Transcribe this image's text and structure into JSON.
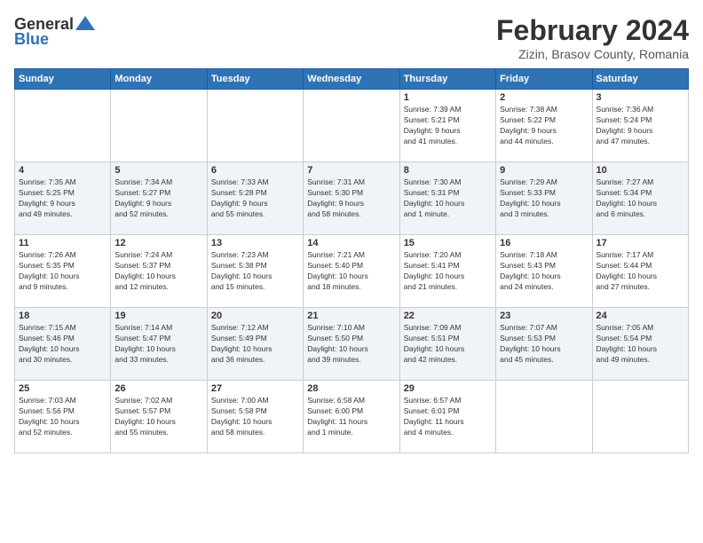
{
  "header": {
    "logo_line1": "General",
    "logo_line2": "Blue",
    "title": "February 2024",
    "subtitle": "Zizin, Brasov County, Romania"
  },
  "weekdays": [
    "Sunday",
    "Monday",
    "Tuesday",
    "Wednesday",
    "Thursday",
    "Friday",
    "Saturday"
  ],
  "weeks": [
    [
      {
        "day": "",
        "detail": ""
      },
      {
        "day": "",
        "detail": ""
      },
      {
        "day": "",
        "detail": ""
      },
      {
        "day": "",
        "detail": ""
      },
      {
        "day": "1",
        "detail": "Sunrise: 7:39 AM\nSunset: 5:21 PM\nDaylight: 9 hours\nand 41 minutes."
      },
      {
        "day": "2",
        "detail": "Sunrise: 7:38 AM\nSunset: 5:22 PM\nDaylight: 9 hours\nand 44 minutes."
      },
      {
        "day": "3",
        "detail": "Sunrise: 7:36 AM\nSunset: 5:24 PM\nDaylight: 9 hours\nand 47 minutes."
      }
    ],
    [
      {
        "day": "4",
        "detail": "Sunrise: 7:35 AM\nSunset: 5:25 PM\nDaylight: 9 hours\nand 49 minutes."
      },
      {
        "day": "5",
        "detail": "Sunrise: 7:34 AM\nSunset: 5:27 PM\nDaylight: 9 hours\nand 52 minutes."
      },
      {
        "day": "6",
        "detail": "Sunrise: 7:33 AM\nSunset: 5:28 PM\nDaylight: 9 hours\nand 55 minutes."
      },
      {
        "day": "7",
        "detail": "Sunrise: 7:31 AM\nSunset: 5:30 PM\nDaylight: 9 hours\nand 58 minutes."
      },
      {
        "day": "8",
        "detail": "Sunrise: 7:30 AM\nSunset: 5:31 PM\nDaylight: 10 hours\nand 1 minute."
      },
      {
        "day": "9",
        "detail": "Sunrise: 7:29 AM\nSunset: 5:33 PM\nDaylight: 10 hours\nand 3 minutes."
      },
      {
        "day": "10",
        "detail": "Sunrise: 7:27 AM\nSunset: 5:34 PM\nDaylight: 10 hours\nand 6 minutes."
      }
    ],
    [
      {
        "day": "11",
        "detail": "Sunrise: 7:26 AM\nSunset: 5:35 PM\nDaylight: 10 hours\nand 9 minutes."
      },
      {
        "day": "12",
        "detail": "Sunrise: 7:24 AM\nSunset: 5:37 PM\nDaylight: 10 hours\nand 12 minutes."
      },
      {
        "day": "13",
        "detail": "Sunrise: 7:23 AM\nSunset: 5:38 PM\nDaylight: 10 hours\nand 15 minutes."
      },
      {
        "day": "14",
        "detail": "Sunrise: 7:21 AM\nSunset: 5:40 PM\nDaylight: 10 hours\nand 18 minutes."
      },
      {
        "day": "15",
        "detail": "Sunrise: 7:20 AM\nSunset: 5:41 PM\nDaylight: 10 hours\nand 21 minutes."
      },
      {
        "day": "16",
        "detail": "Sunrise: 7:18 AM\nSunset: 5:43 PM\nDaylight: 10 hours\nand 24 minutes."
      },
      {
        "day": "17",
        "detail": "Sunrise: 7:17 AM\nSunset: 5:44 PM\nDaylight: 10 hours\nand 27 minutes."
      }
    ],
    [
      {
        "day": "18",
        "detail": "Sunrise: 7:15 AM\nSunset: 5:46 PM\nDaylight: 10 hours\nand 30 minutes."
      },
      {
        "day": "19",
        "detail": "Sunrise: 7:14 AM\nSunset: 5:47 PM\nDaylight: 10 hours\nand 33 minutes."
      },
      {
        "day": "20",
        "detail": "Sunrise: 7:12 AM\nSunset: 5:49 PM\nDaylight: 10 hours\nand 36 minutes."
      },
      {
        "day": "21",
        "detail": "Sunrise: 7:10 AM\nSunset: 5:50 PM\nDaylight: 10 hours\nand 39 minutes."
      },
      {
        "day": "22",
        "detail": "Sunrise: 7:09 AM\nSunset: 5:51 PM\nDaylight: 10 hours\nand 42 minutes."
      },
      {
        "day": "23",
        "detail": "Sunrise: 7:07 AM\nSunset: 5:53 PM\nDaylight: 10 hours\nand 45 minutes."
      },
      {
        "day": "24",
        "detail": "Sunrise: 7:05 AM\nSunset: 5:54 PM\nDaylight: 10 hours\nand 49 minutes."
      }
    ],
    [
      {
        "day": "25",
        "detail": "Sunrise: 7:03 AM\nSunset: 5:56 PM\nDaylight: 10 hours\nand 52 minutes."
      },
      {
        "day": "26",
        "detail": "Sunrise: 7:02 AM\nSunset: 5:57 PM\nDaylight: 10 hours\nand 55 minutes."
      },
      {
        "day": "27",
        "detail": "Sunrise: 7:00 AM\nSunset: 5:58 PM\nDaylight: 10 hours\nand 58 minutes."
      },
      {
        "day": "28",
        "detail": "Sunrise: 6:58 AM\nSunset: 6:00 PM\nDaylight: 11 hours\nand 1 minute."
      },
      {
        "day": "29",
        "detail": "Sunrise: 6:57 AM\nSunset: 6:01 PM\nDaylight: 11 hours\nand 4 minutes."
      },
      {
        "day": "",
        "detail": ""
      },
      {
        "day": "",
        "detail": ""
      }
    ]
  ]
}
